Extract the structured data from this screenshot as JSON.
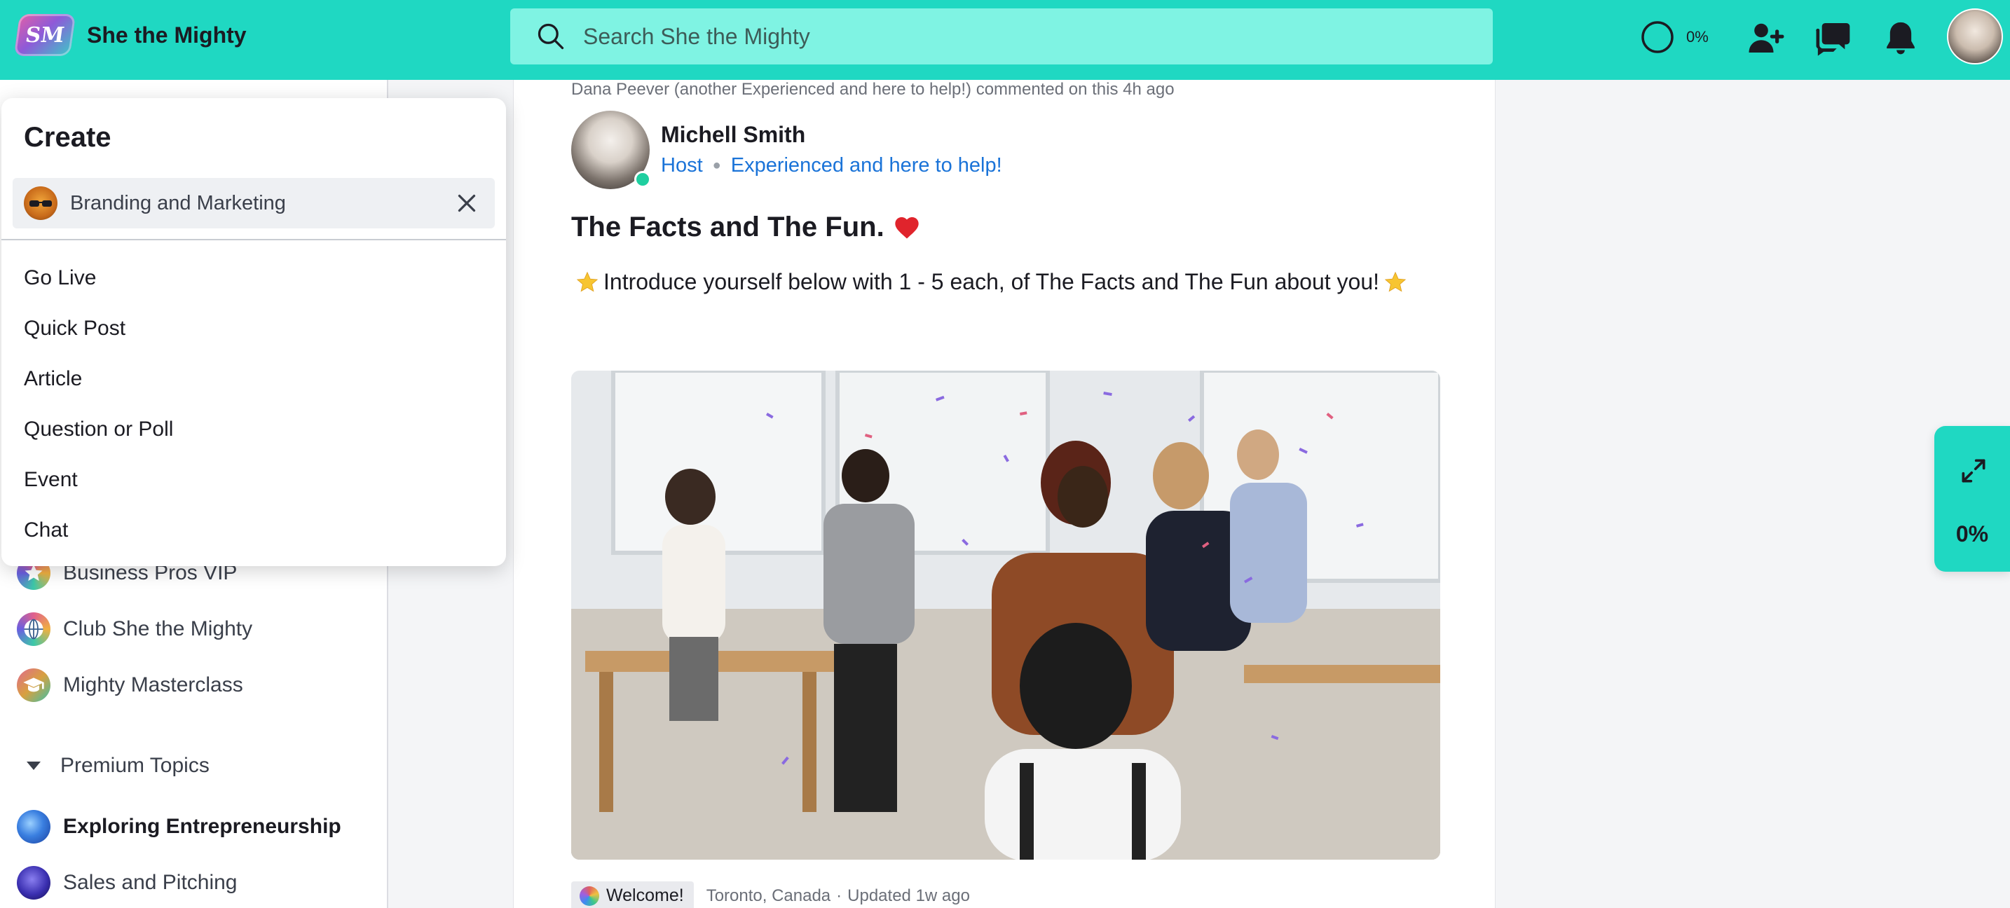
{
  "app": {
    "name": "She the Mighty",
    "logo_text": "SM",
    "accent_color": "#1fd8c2"
  },
  "search": {
    "placeholder": "Search She the Mighty"
  },
  "header": {
    "progress_label": "0%",
    "icons": [
      "progress-ring-icon",
      "add-person-icon",
      "chat-bubbles-icon",
      "bell-icon",
      "user-avatar"
    ]
  },
  "create_menu": {
    "title": "Create",
    "selected_space": "Branding and Marketing",
    "items": [
      "Go Live",
      "Quick Post",
      "Article",
      "Question or Poll",
      "Event",
      "Chat"
    ]
  },
  "sidebar": {
    "items": [
      {
        "label": "Business Pros VIP",
        "icon": "star-badge-icon"
      },
      {
        "label": "Club She the Mighty",
        "icon": "globe-icon"
      },
      {
        "label": "Mighty Masterclass",
        "icon": "graduation-cap-icon"
      }
    ],
    "section": {
      "label": "Premium Topics"
    },
    "section_items": [
      {
        "label": "Exploring Entrepreneurship",
        "icon": "blue-mosaic-icon",
        "active": true
      },
      {
        "label": "Sales and Pitching",
        "icon": "planet-icon",
        "active": false
      }
    ]
  },
  "post": {
    "activity": "Dana Peever (another Experienced and here to help!) commented on this 4h ago",
    "author": {
      "name": "Michell Smith",
      "role": "Host",
      "title": "Experienced and here to help!",
      "online": true
    },
    "title": "The Facts and The Fun.",
    "body": "Introduce yourself below with 1 - 5 each, of The Facts and The Fun about you!",
    "tag": "Welcome!",
    "location": "Toronto, Canada",
    "separator": "·",
    "updated": "Updated 1w ago"
  },
  "float_widget": {
    "progress_label": "0%"
  }
}
